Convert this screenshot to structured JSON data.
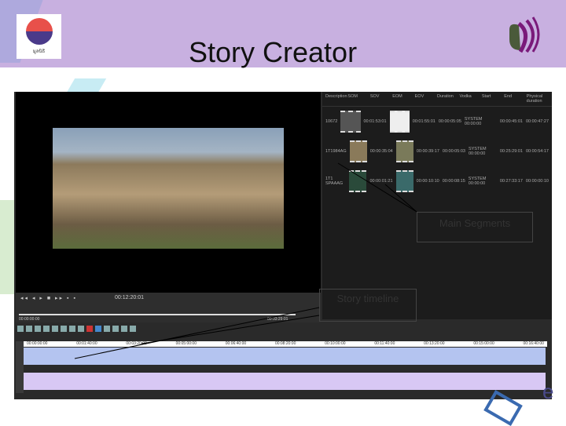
{
  "header": {
    "title": "Story Creator",
    "left_logo_text": "มูลนิธิ",
    "right_logo": "speaker-logo"
  },
  "table": {
    "columns": [
      "Description",
      "SOM",
      "SOV",
      "EOM",
      "EOV",
      "Duration",
      "Vodka",
      "Start",
      "End",
      "Physical duration"
    ],
    "rows": [
      {
        "description": "10672",
        "som": "00:01:53:01",
        "eom": "00:01:55:01",
        "duration": "00:00:05:05",
        "vodka": "SYSTEM 00:00:00",
        "end": "00:00:45:01",
        "phys": "00:00:47:27"
      },
      {
        "description": "1T1984AG",
        "som": "00:00:35:04",
        "eom": "00:00:39:17",
        "duration": "00:00:05:03",
        "vodka": "SYSTEM 00:00:00",
        "end": "00:25:29:01",
        "phys": "00:00:54:17"
      },
      {
        "description": "1T1 SPAAAG",
        "som": "00:00:01:21",
        "eom": "00:00:10:10",
        "duration": "00:00:08:15",
        "vodka": "SYSTEM 00:00:00",
        "end": "00:27:33:17",
        "phys": "00:00:00:10"
      }
    ]
  },
  "player": {
    "timecode": "00:12:20:01",
    "start": "00:00:00:00",
    "end": "00:33:29:01"
  },
  "ruler": [
    "00:00:00:00",
    "00:01:40:00",
    "00:03:20:00",
    "00:05:00:00",
    "00:06:40:00",
    "00:08:20:00",
    "00:10:00:00",
    "00:11:40:00",
    "00:13:20:00",
    "00:15:00:00",
    "00:16:40:00"
  ],
  "callouts": {
    "main_segments": "Main Segments",
    "story_timeline": "Story timeline"
  },
  "footer_letter": "e"
}
